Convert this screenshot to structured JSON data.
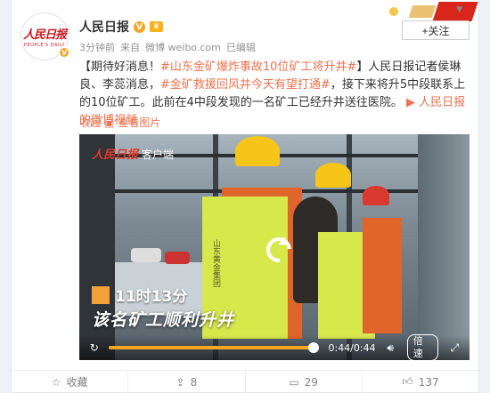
{
  "author": {
    "name": "人民日报",
    "avatar_logo_cn": "人民日报",
    "avatar_logo_en": "PEOPLE'S DAILY",
    "verified_icon": "verified-icon"
  },
  "meta": {
    "time": "3分钟前",
    "source_prefix": "来自",
    "source": "微博 weibo.com",
    "edited": "已编辑"
  },
  "follow": {
    "label": "+关注"
  },
  "post": {
    "prefix": "【期待好消息！",
    "tag1": "#山东金矿爆炸事故10位矿工将升井#",
    "after_tag1": "】人民日报记者侯琳良、李蕊消息，",
    "tag2": "#金矿救援回风井今天有望打通#",
    "after_tag2": "，接下来将升5中段联系上的10位矿工。此前在4中段发现的一名矿工已经升井送往医院。",
    "video_link": "人民日报的微博视频"
  },
  "collapse": {
    "label": "收起",
    "view_image": "查看图片"
  },
  "video": {
    "watermark_brand": "人民日报",
    "watermark_label": "客户端",
    "vest_text": "山东黄金集团",
    "time_caption": "11时13分",
    "subtitle": "该名矿工顺利升井",
    "current_time": "0:44",
    "duration": "0:44",
    "time_readout": "0:44/0:44",
    "progress": 1.0,
    "speed_label": "倍速"
  },
  "footer": {
    "favorite_label": "收藏",
    "repost_count": "8",
    "comment_count": "29",
    "like_count": "137"
  },
  "colors": {
    "link": "#eb7350",
    "accent": "#f5a623",
    "brand_red": "#c8161d"
  }
}
